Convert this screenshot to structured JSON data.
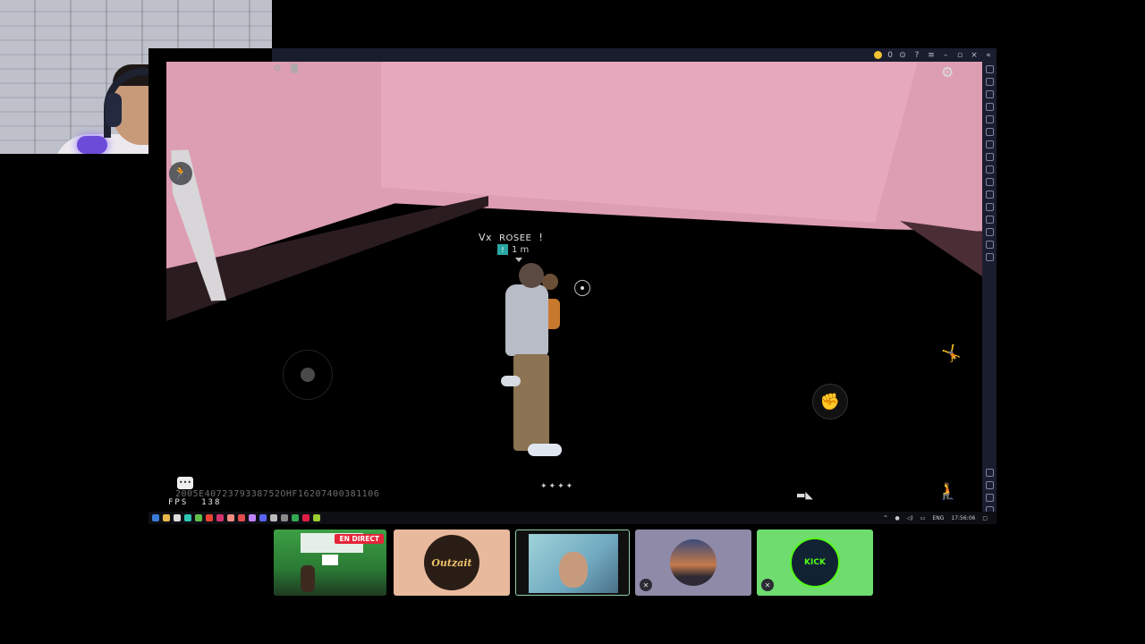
{
  "window": {
    "coin_count": "0",
    "fps_label": "FPS",
    "fps_value": "138",
    "seed_text": "2005E4072379338752OHF16207400381106"
  },
  "game": {
    "player_prefix": "Vx",
    "player_name": "ROSEE",
    "player_suffix": "!",
    "distance_rank": "!",
    "distance": "1 m"
  },
  "taskbar": {
    "language": "ENG",
    "time": "17:56:06"
  },
  "participants": {
    "live_badge": "EN DIRECT",
    "outzait_logo": "Outzait",
    "kick_logo": "KICK"
  },
  "icons": {
    "settings": "gear-icon",
    "run": "running-figure-icon",
    "punch": "fist-icon",
    "jump": "jump-icon",
    "crouch": "crouch-icon",
    "weapon": "rifle-icon",
    "chat": "chat-icon",
    "muted": "mic-muted-icon"
  },
  "colors": {
    "live_badge": "#e5253a",
    "pink_wall": "#dd9db2",
    "active_tile_border": "#8fd0a9",
    "kick_green": "#53fc18"
  }
}
